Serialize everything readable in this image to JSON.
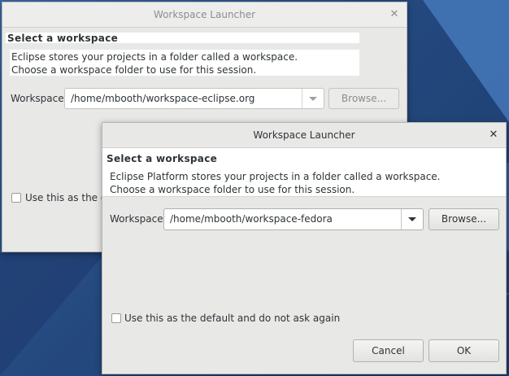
{
  "background_window": {
    "title": "Workspace Launcher",
    "header_title": "Select a workspace",
    "message_line1": "Eclipse stores your projects in a folder called a workspace.",
    "message_line2": "Choose a workspace folder to use for this session.",
    "workspace_label": "Workspace:",
    "workspace_value": "/home/mbooth/workspace-eclipse.org",
    "browse_label": "Browse...",
    "checkbox_label_partial": "Use this as the def"
  },
  "dialog": {
    "title": "Workspace Launcher",
    "header_title": "Select a workspace",
    "message_line1": "Eclipse Platform stores your projects in a folder called a workspace.",
    "message_line2": "Choose a workspace folder to use for this session.",
    "workspace_label": "Workspace:",
    "workspace_value": "/home/mbooth/workspace-fedora",
    "browse_label": "Browse...",
    "checkbox_label": "Use this as the default and do not ask again",
    "cancel_label": "Cancel",
    "ok_label": "OK"
  },
  "icons": {
    "close": "close-icon",
    "dropdown": "chevron-down-icon"
  },
  "colors": {
    "desktop_blue": "#2b4f86",
    "window_bg": "#e8e8e7"
  }
}
